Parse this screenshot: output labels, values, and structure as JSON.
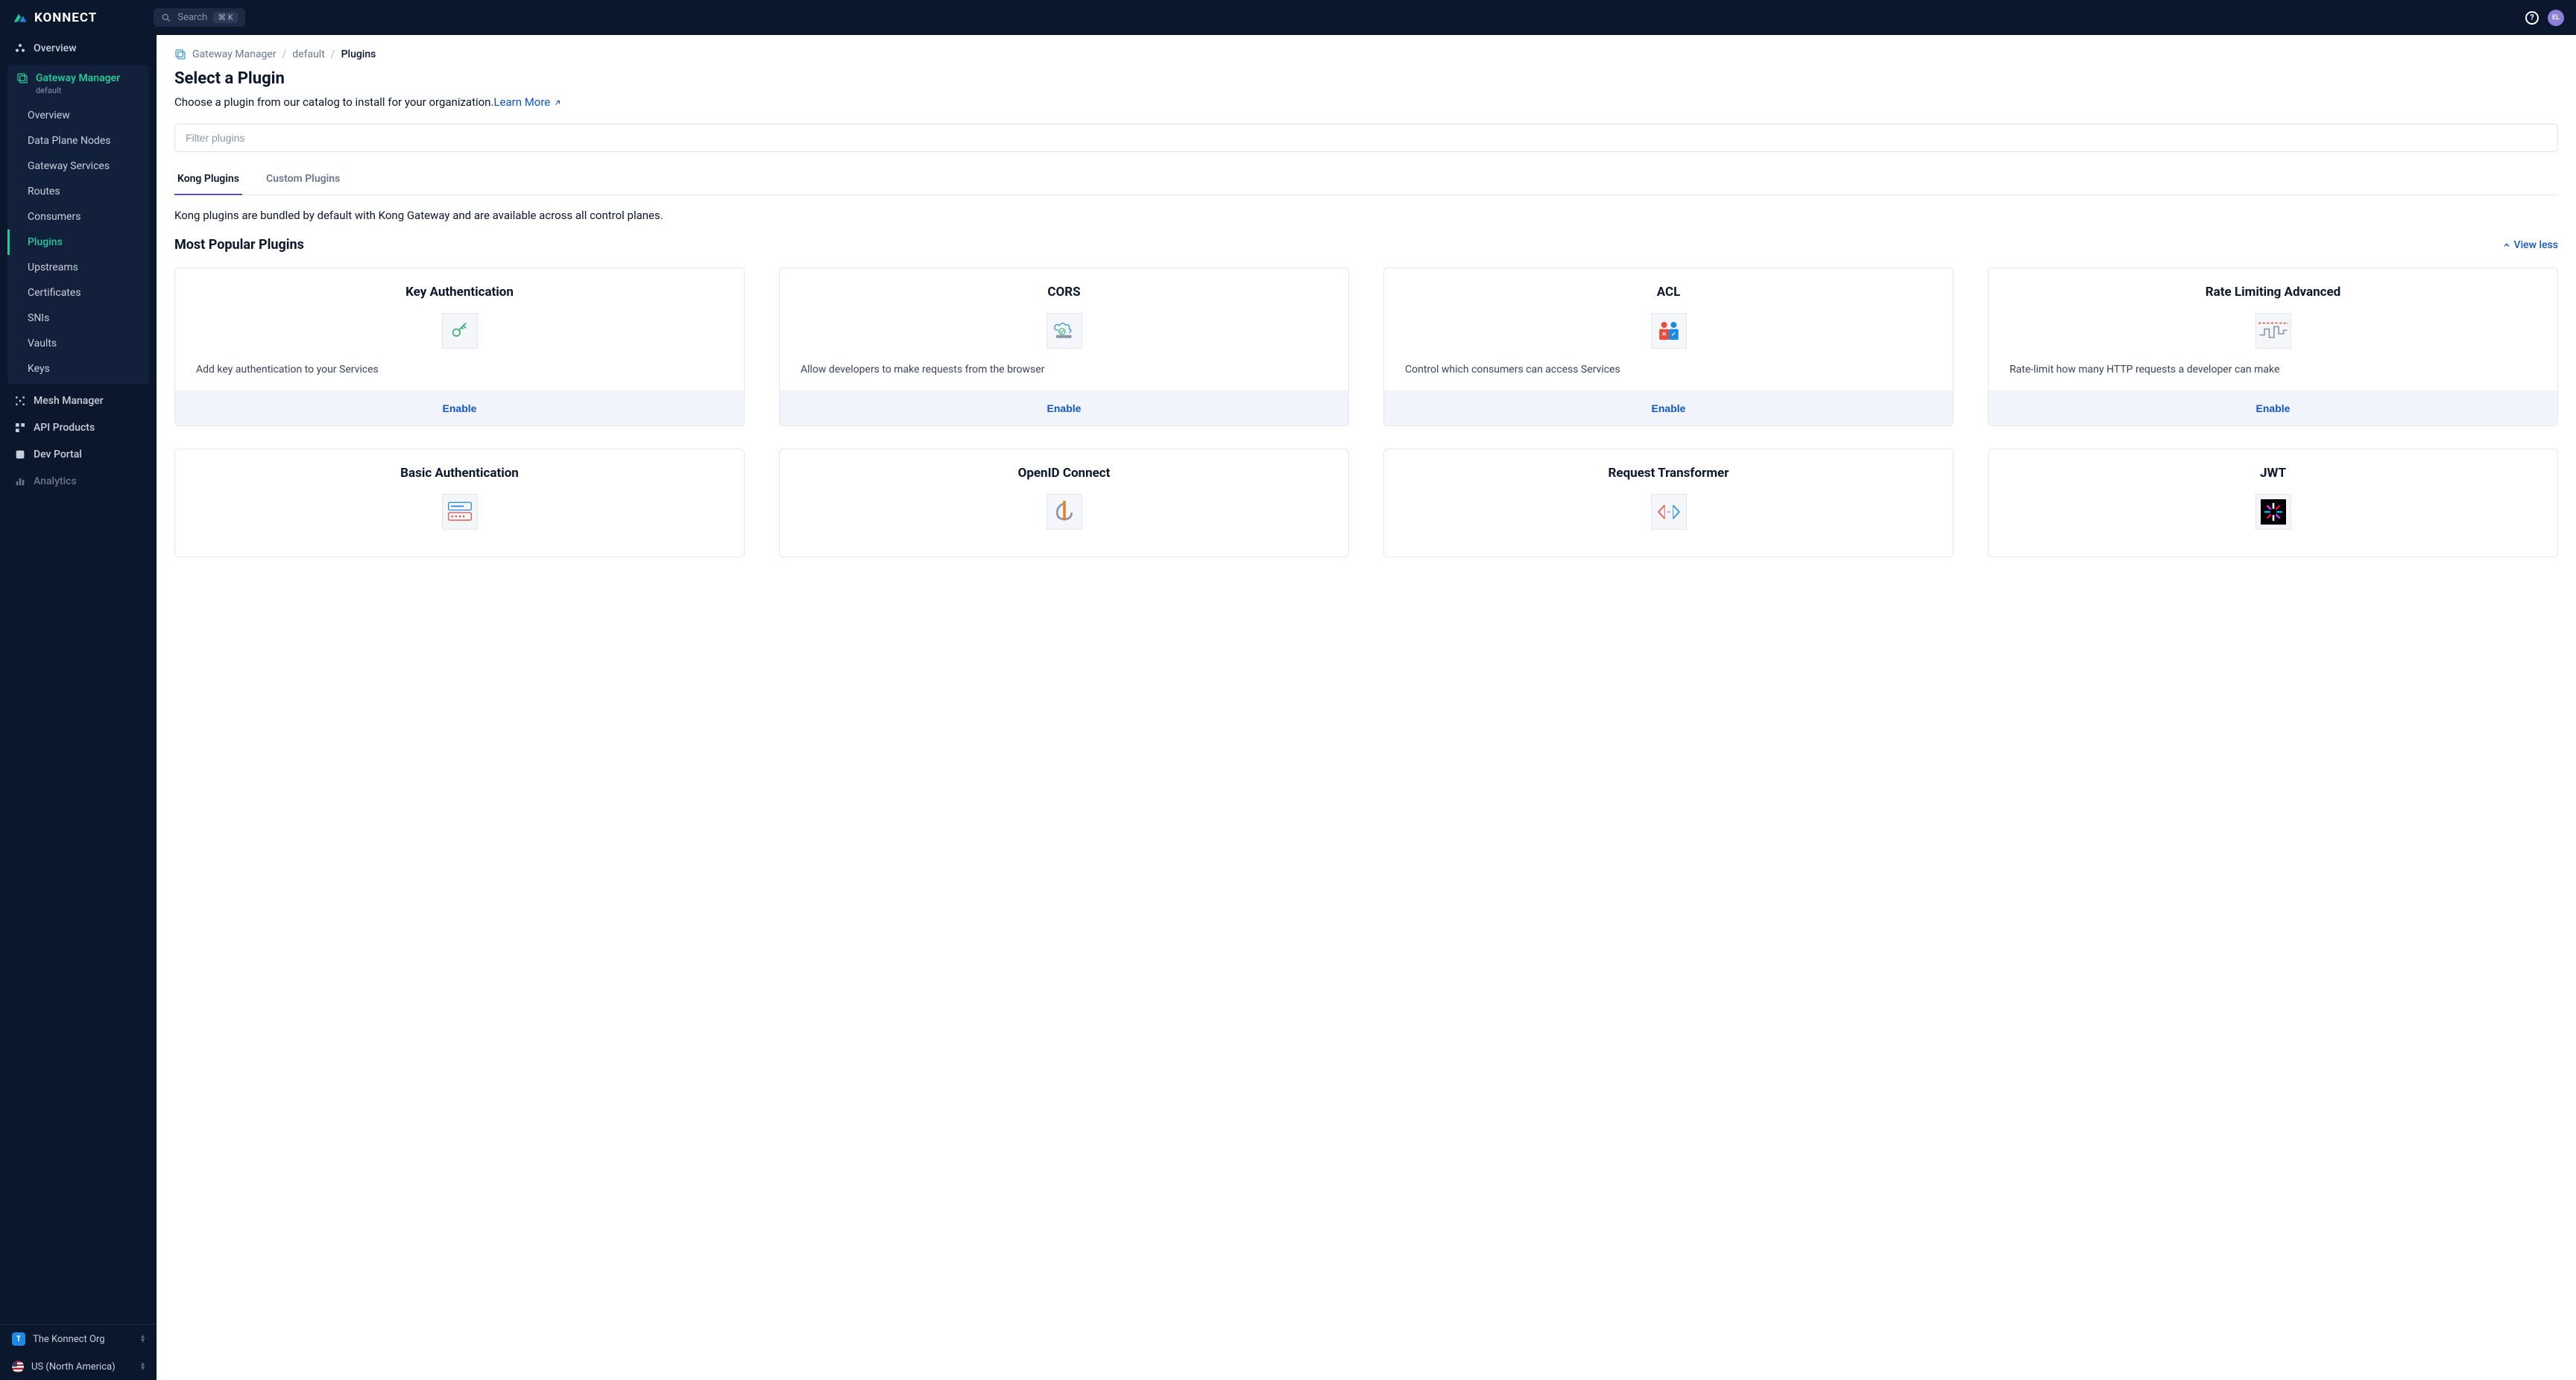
{
  "brand": "KONNECT",
  "topbar": {
    "search_label": "Search",
    "search_kbd": "⌘ K",
    "avatar_initials": "EL"
  },
  "sidebar": {
    "top": [
      {
        "id": "overview",
        "label": "Overview",
        "icon": "overview-icon"
      }
    ],
    "gateway": {
      "label": "Gateway Manager",
      "sub": "default",
      "items": [
        {
          "id": "gw-overview",
          "label": "Overview"
        },
        {
          "id": "data-plane-nodes",
          "label": "Data Plane Nodes"
        },
        {
          "id": "gateway-services",
          "label": "Gateway Services"
        },
        {
          "id": "routes",
          "label": "Routes"
        },
        {
          "id": "consumers",
          "label": "Consumers"
        },
        {
          "id": "plugins",
          "label": "Plugins",
          "active": true
        },
        {
          "id": "upstreams",
          "label": "Upstreams"
        },
        {
          "id": "certificates",
          "label": "Certificates"
        },
        {
          "id": "snis",
          "label": "SNIs"
        },
        {
          "id": "vaults",
          "label": "Vaults"
        },
        {
          "id": "keys",
          "label": "Keys"
        }
      ]
    },
    "bottom": [
      {
        "id": "mesh-manager",
        "label": "Mesh Manager",
        "icon": "mesh-icon"
      },
      {
        "id": "api-products",
        "label": "API Products",
        "icon": "api-products-icon"
      },
      {
        "id": "dev-portal",
        "label": "Dev Portal",
        "icon": "dev-portal-icon"
      },
      {
        "id": "analytics",
        "label": "Analytics",
        "icon": "analytics-icon"
      }
    ],
    "footer": {
      "org_chip": "T",
      "org_name": "The Konnect Org",
      "region": "US (North America)"
    }
  },
  "breadcrumb": {
    "root": "Gateway Manager",
    "scope": "default",
    "current": "Plugins"
  },
  "page": {
    "title": "Select a Plugin",
    "desc": "Choose a plugin from our catalog to install for your organization.",
    "learn_more": "Learn More",
    "filter_placeholder": "Filter plugins"
  },
  "tabs": {
    "kong": "Kong Plugins",
    "custom": "Custom Plugins"
  },
  "kong_desc": "Kong plugins are bundled by default with Kong Gateway and are available across all control planes.",
  "popular": {
    "title": "Most Popular Plugins",
    "toggle": "View less"
  },
  "enable_label": "Enable",
  "plugins": [
    {
      "id": "key-auth",
      "name": "Key Authentication",
      "desc": "Add key authentication to your Services",
      "icon": "key"
    },
    {
      "id": "cors",
      "name": "CORS",
      "desc": "Allow developers to make requests from the browser",
      "icon": "cors"
    },
    {
      "id": "acl",
      "name": "ACL",
      "desc": "Control which consumers can access Services",
      "icon": "acl"
    },
    {
      "id": "rate-limiting-advanced",
      "name": "Rate Limiting Advanced",
      "desc": "Rate-limit how many HTTP requests a developer can make",
      "icon": "rate"
    },
    {
      "id": "basic-auth",
      "name": "Basic Authentication",
      "desc": "",
      "icon": "basic"
    },
    {
      "id": "openid-connect",
      "name": "OpenID Connect",
      "desc": "",
      "icon": "oidc"
    },
    {
      "id": "request-transformer",
      "name": "Request Transformer",
      "desc": "",
      "icon": "reqx"
    },
    {
      "id": "jwt",
      "name": "JWT",
      "desc": "",
      "icon": "jwt"
    }
  ]
}
